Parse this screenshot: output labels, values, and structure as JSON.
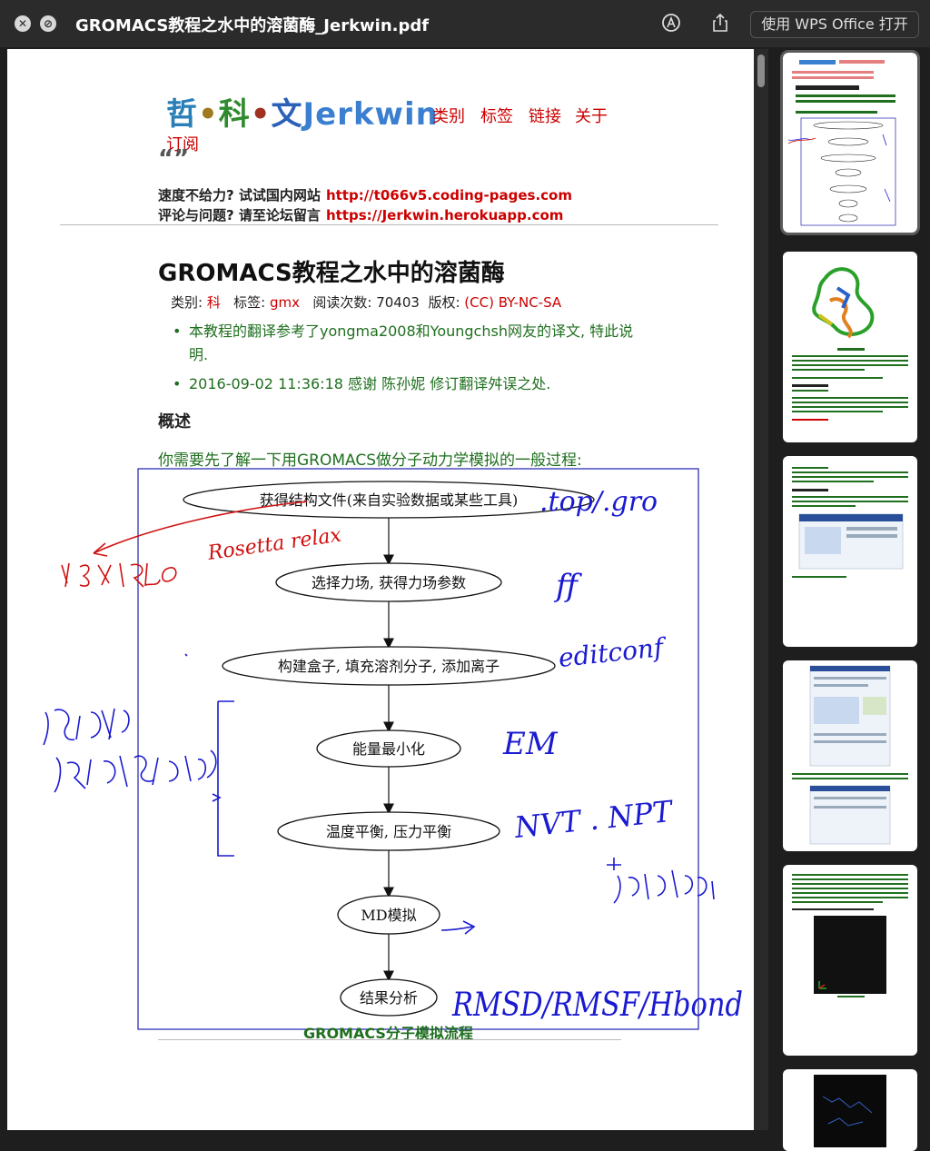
{
  "window": {
    "title": "GROMACS教程之水中的溶菌酶_Jerkwin.pdf",
    "open_with": "使用 WPS Office 打开"
  },
  "header": {
    "logo": [
      "哲",
      "•",
      "科",
      "•",
      "文",
      "Jerkwin"
    ],
    "nav": [
      "类别",
      "标签",
      "链接",
      "关于",
      "订阅"
    ],
    "quote_mark": "“”",
    "speed_text": "速度不给力? 试试国内网站",
    "speed_link": "http://t066v5.coding-pages.com",
    "comment_text": "评论与问题? 请至论坛留言",
    "comment_link": "https://Jerkwin.herokuapp.com"
  },
  "post": {
    "title": "GROMACS教程之水中的溶菌酶",
    "meta": {
      "category_label": "类别:",
      "category": "科",
      "tag_label": "标签:",
      "tag": "gmx",
      "views_label": "阅读次数:",
      "views": "70403",
      "license_label": "版权:",
      "license": "(CC) BY-NC-SA"
    },
    "bullets": [
      "本教程的翻译参考了yongma2008和Youngchsh网友的译文, 特此说明.",
      "2016-09-02 11:36:18 感谢 陈孙妮 修订翻译舛误之处."
    ],
    "section_heading": "概述",
    "intro": "你需要先了解一下用GROMACS做分子动力学模拟的一般过程:",
    "caption": "GROMACS分子模拟流程"
  },
  "flowchart": {
    "steps": [
      "获得结构文件(来自实验数据或某些工具)",
      "选择力场, 获得力场参数",
      "构建盒子, 填充溶剂分子, 添加离子",
      "能量最小化",
      "温度平衡, 压力平衡",
      "MD模拟",
      "结果分析"
    ]
  },
  "annotations": {
    "red_arrow_text": "Rosetta relax",
    "notes": [
      ".top/.gro",
      "ff",
      "editconf",
      "EM",
      "NVT . NPT",
      "RMSD/RMSF/Hbond"
    ]
  },
  "colors": {
    "accent_red": "#cc0000",
    "body_green": "#1f6f1f",
    "ink_blue": "#1a1ad0",
    "ink_red": "#d01010"
  }
}
